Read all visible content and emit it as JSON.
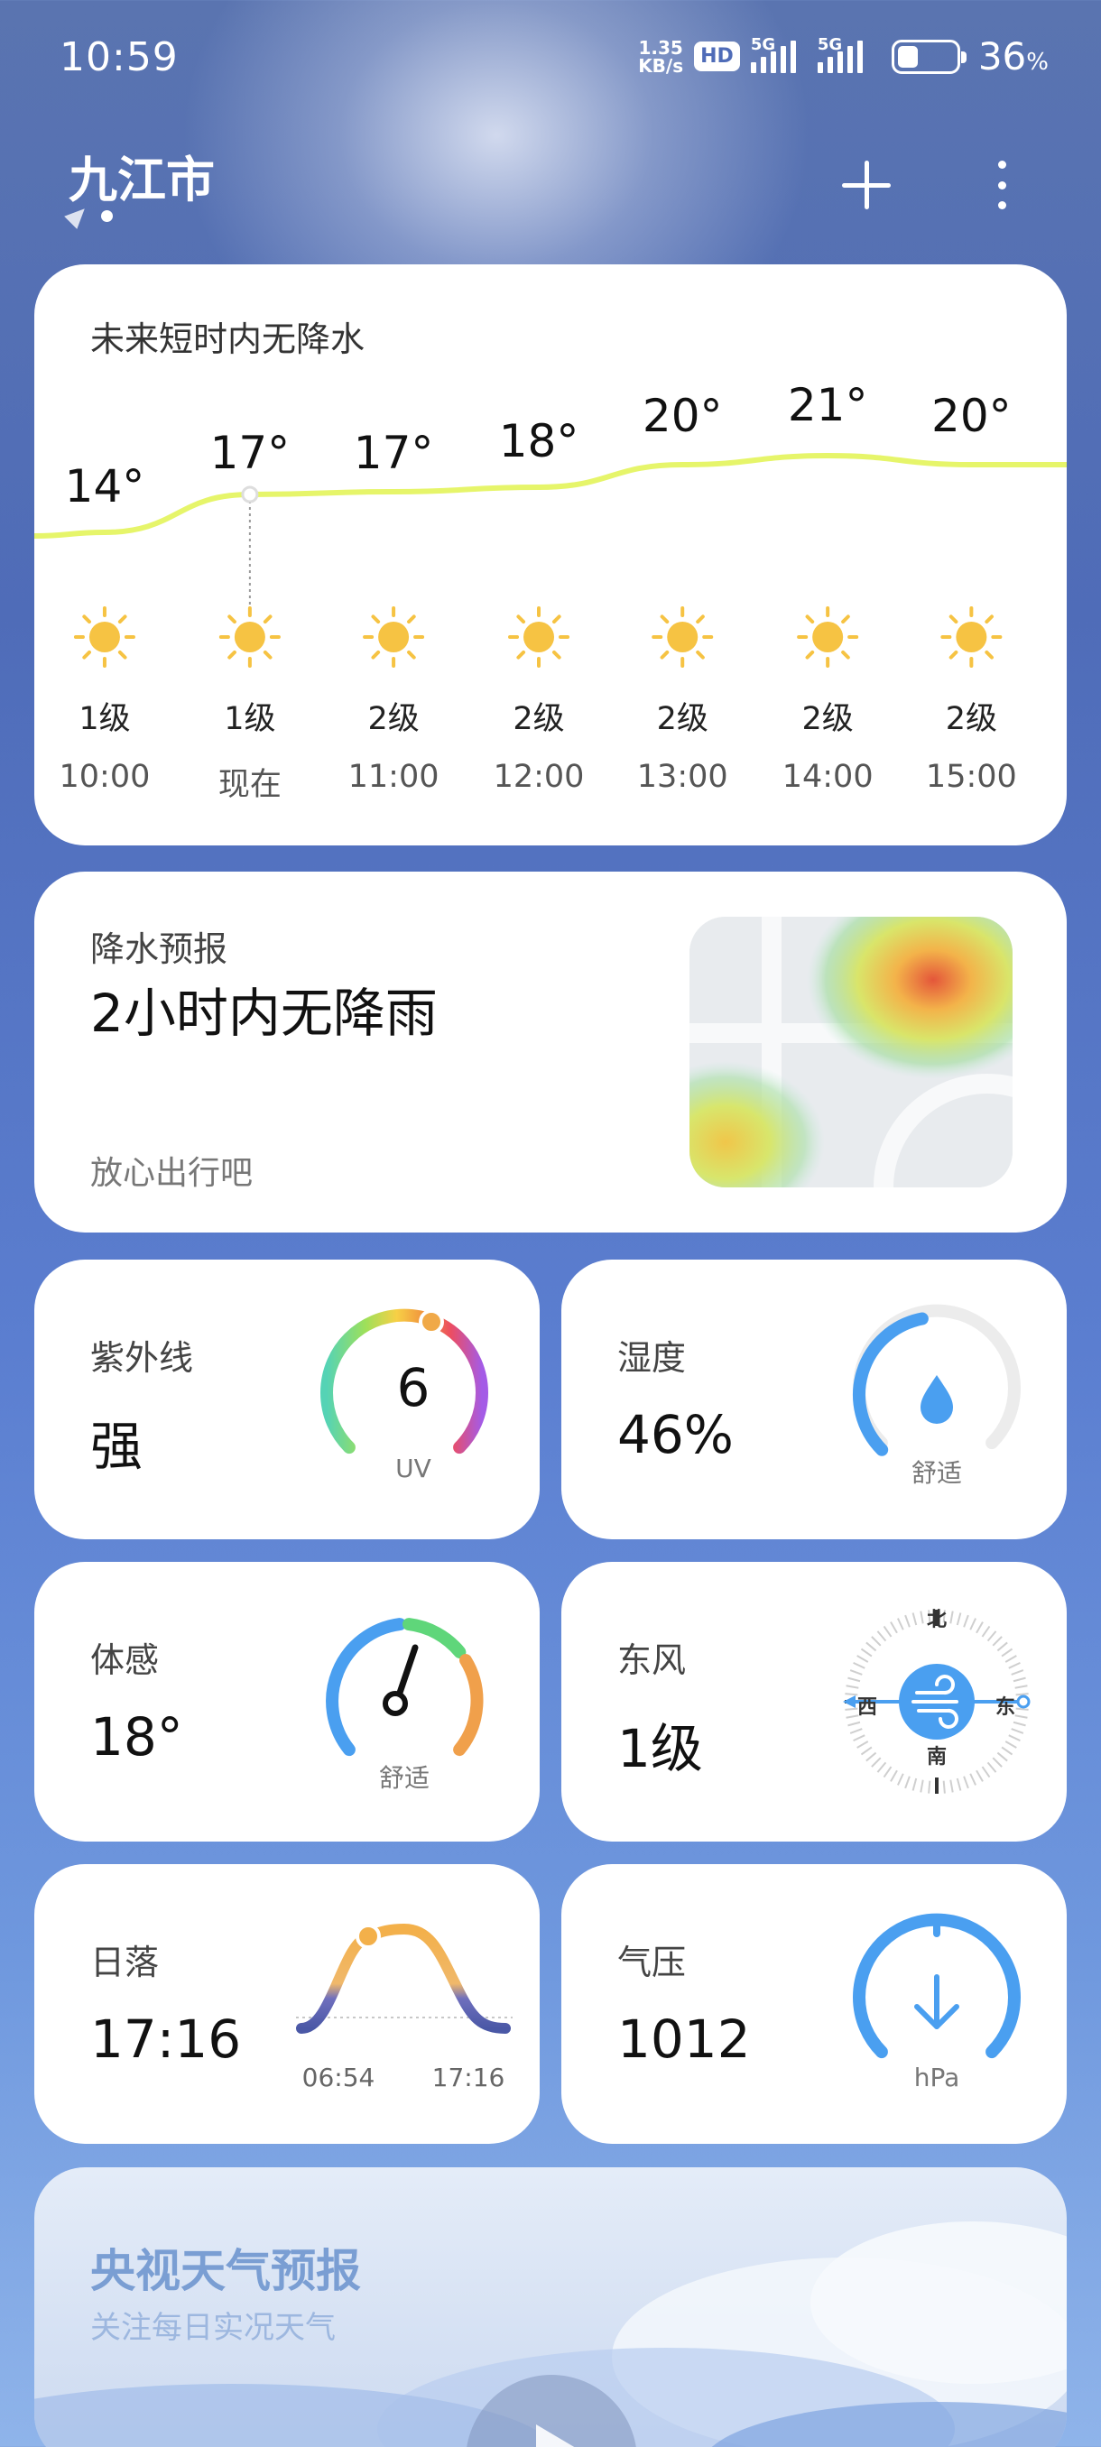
{
  "status_bar": {
    "time": "10:59",
    "net_speed_value": "1.35",
    "net_speed_unit": "KB/s",
    "hd_label": "HD",
    "signal1_label": "5G",
    "signal2_label": "5G",
    "battery_percent": "36",
    "battery_unit": "%",
    "battery_level": 0.36
  },
  "header": {
    "city": "九江市"
  },
  "hourly": {
    "title": "未来短时内无降水",
    "items": [
      {
        "temp": "14°",
        "wind": "1级",
        "hour": "10:00",
        "icon": "sun-icon"
      },
      {
        "temp": "17°",
        "wind": "1级",
        "hour": "现在",
        "icon": "sun-icon"
      },
      {
        "temp": "17°",
        "wind": "2级",
        "hour": "11:00",
        "icon": "sun-icon"
      },
      {
        "temp": "18°",
        "wind": "2级",
        "hour": "12:00",
        "icon": "sun-icon"
      },
      {
        "temp": "20°",
        "wind": "2级",
        "hour": "13:00",
        "icon": "sun-icon"
      },
      {
        "temp": "21°",
        "wind": "2级",
        "hour": "14:00",
        "icon": "sun-icon"
      },
      {
        "temp": "20°",
        "wind": "2级",
        "hour": "15:00",
        "icon": "sun-icon"
      }
    ]
  },
  "precipitation": {
    "label": "降水预报",
    "headline": "2小时内无降雨",
    "subtext": "放心出行吧"
  },
  "uv": {
    "label": "紫外线",
    "value": "强",
    "index": "6",
    "unit": "UV"
  },
  "humidity": {
    "label": "湿度",
    "value": "46%",
    "status": "舒适",
    "fraction": 0.46
  },
  "feels_like": {
    "label": "体感",
    "value": "18°",
    "status": "舒适"
  },
  "wind": {
    "label": "东风",
    "value": "1级",
    "north": "北",
    "south": "南",
    "west": "西",
    "east": "东"
  },
  "sunset": {
    "label": "日落",
    "value": "17:16",
    "sunrise_time": "06:54",
    "sunset_time": "17:16"
  },
  "pressure": {
    "label": "气压",
    "value": "1012",
    "unit": "hPa"
  },
  "cctv": {
    "title": "央视天气预报",
    "subtitle": "关注每日实况天气"
  },
  "colors": {
    "temp_curve": "#e6f56a",
    "sun": "#f6c343",
    "accent_blue": "#4a9ff0"
  }
}
